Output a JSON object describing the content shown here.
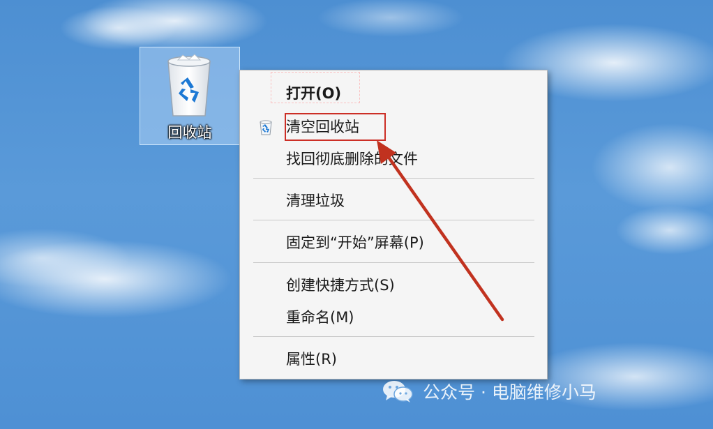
{
  "desktop": {
    "recycle_bin_label": "回收站",
    "recycle_bin_icon": "recycle-bin-icon"
  },
  "context_menu": {
    "items": [
      {
        "label": "打开(O)",
        "bold": true
      },
      {
        "label": "清空回收站",
        "icon": "recycle-bin-icon",
        "highlighted": true
      },
      {
        "label": "找回彻底删除的文件"
      },
      {
        "label": "清理垃圾"
      },
      {
        "label": "固定到“开始”屏幕(P)"
      },
      {
        "label": "创建快捷方式(S)"
      },
      {
        "label": "重命名(M)"
      },
      {
        "label": "属性(R)"
      }
    ]
  },
  "annotation": {
    "highlight_color": "#cc2f26",
    "arrow_color": "#c1321f",
    "target": "清空回收站"
  },
  "watermark": {
    "icon": "wechat-icon",
    "text": "公众号 · 电脑维修小马"
  }
}
